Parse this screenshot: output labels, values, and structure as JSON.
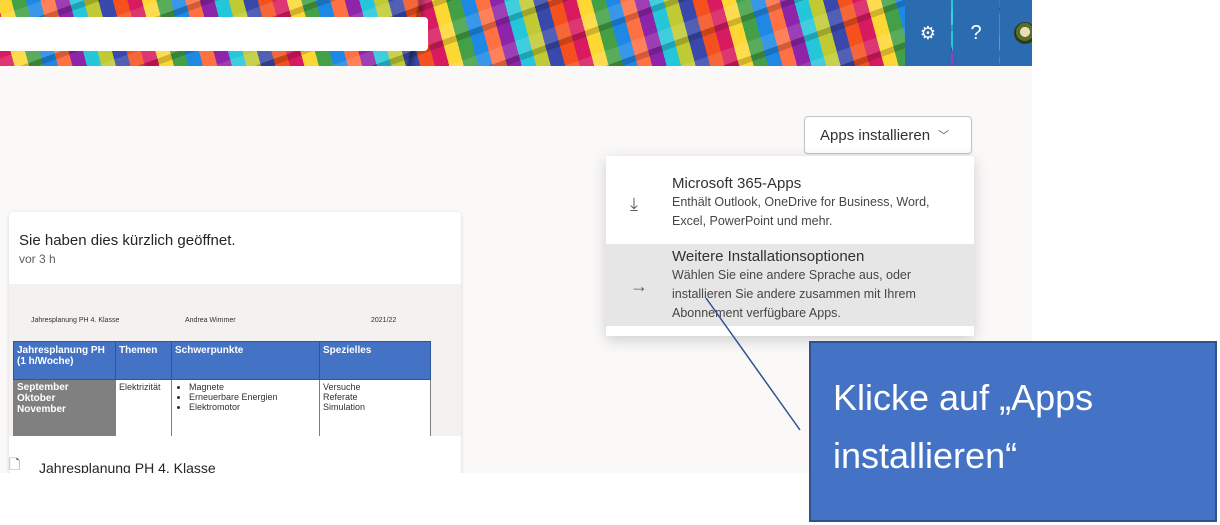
{
  "header": {
    "search_placeholder": "",
    "settings_icon": "gear-icon",
    "help_label": "?",
    "accent": "#2b6cb0"
  },
  "apps_button": {
    "label": "Apps installieren",
    "chevron": "﹀"
  },
  "install_menu": {
    "items": [
      {
        "icon": "download-icon",
        "glyph": "⤓",
        "title": "Microsoft 365-Apps",
        "description": "Enthält Outlook, OneDrive for Business, Word, Excel, PowerPoint und mehr."
      },
      {
        "icon": "arrow-right-icon",
        "glyph": "→",
        "title": "Weitere Installationsoptionen",
        "description": "Wählen Sie eine andere Sprache aus, oder installieren Sie andere zusammen mit Ihrem Abonnement verfügbare Apps."
      }
    ]
  },
  "recent_card": {
    "title": "Sie haben dies kürzlich geöffnet.",
    "time": "vor 3 h",
    "file_name": "Jahresplanung PH 4. Klasse",
    "preview": {
      "doc_title": "Jahresplanung PH 4. Klasse",
      "author": "Andrea Wimmer",
      "year": "2021/22",
      "headers": [
        "Jahresplanung PH (1 h/Woche)",
        "Themen",
        "Schwerpunkte",
        "Spezielles"
      ],
      "months": [
        "September",
        "Oktober",
        "November"
      ],
      "theme": "Elektrizität",
      "focus": [
        "Magnete",
        "Erneuerbare Energien",
        "Elektromotor"
      ],
      "special": [
        "Versuche",
        "Referate",
        "Simulation"
      ]
    }
  },
  "callout": {
    "line1": "Klicke auf „Apps",
    "line2": "installieren“",
    "color": "#4472c4"
  }
}
